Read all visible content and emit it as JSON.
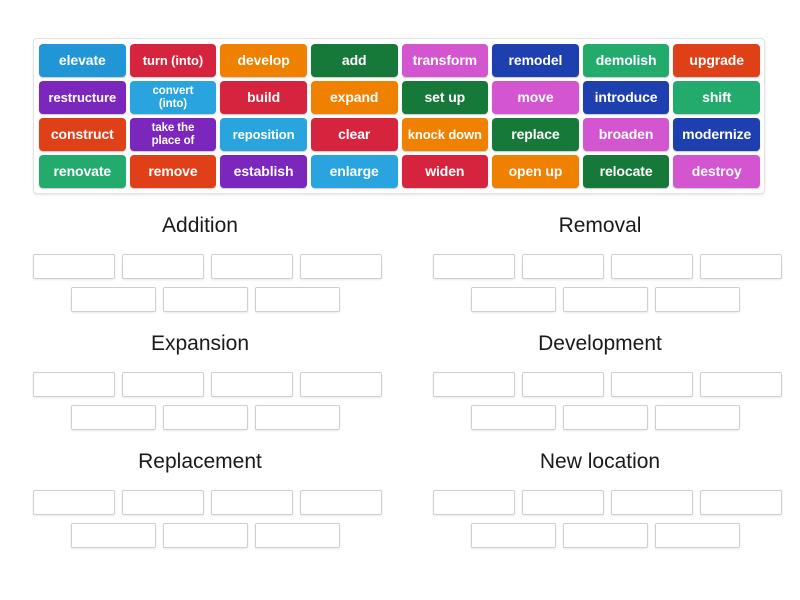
{
  "activity": {
    "type": "group-sort",
    "tile_text_color": "#ffffff",
    "page_background": "#ffffff",
    "panel_border_color": "#e2e2e2",
    "slot_border_color": "#cfcfcf"
  },
  "wordbank": {
    "rows": [
      [
        {
          "label": "elevate",
          "color": "#2196d6"
        },
        {
          "label": "turn (into)",
          "color": "#d7243e"
        },
        {
          "label": "develop",
          "color": "#f08000"
        },
        {
          "label": "add",
          "color": "#16793a"
        },
        {
          "label": "transform",
          "color": "#d355cf"
        },
        {
          "label": "remodel",
          "color": "#1d3fb0"
        },
        {
          "label": "demolish",
          "color": "#23ab6e"
        },
        {
          "label": "upgrade",
          "color": "#df4017"
        }
      ],
      [
        {
          "label": "restructure",
          "color": "#7b26bd"
        },
        {
          "label": "convert\n(into)",
          "color": "#29a4de"
        },
        {
          "label": "build",
          "color": "#d7243e"
        },
        {
          "label": "expand",
          "color": "#f08000"
        },
        {
          "label": "set up",
          "color": "#16793a"
        },
        {
          "label": "move",
          "color": "#d355cf"
        },
        {
          "label": "introduce",
          "color": "#1d3fb0"
        },
        {
          "label": "shift",
          "color": "#23ab6e"
        }
      ],
      [
        {
          "label": "construct",
          "color": "#df4017"
        },
        {
          "label": "take the\nplace of",
          "color": "#7b26bd"
        },
        {
          "label": "reposition",
          "color": "#29a4de"
        },
        {
          "label": "clear",
          "color": "#d7243e"
        },
        {
          "label": "knock down",
          "color": "#f08000"
        },
        {
          "label": "replace",
          "color": "#16793a"
        },
        {
          "label": "broaden",
          "color": "#d355cf"
        },
        {
          "label": "modernize",
          "color": "#1d3fb0"
        }
      ],
      [
        {
          "label": "renovate",
          "color": "#23ab6e"
        },
        {
          "label": "remove",
          "color": "#df4017"
        },
        {
          "label": "establish",
          "color": "#7b26bd"
        },
        {
          "label": "enlarge",
          "color": "#29a4de"
        },
        {
          "label": "widen",
          "color": "#d7243e"
        },
        {
          "label": "open up",
          "color": "#f08000"
        },
        {
          "label": "relocate",
          "color": "#16793a"
        },
        {
          "label": "destroy",
          "color": "#d355cf"
        }
      ]
    ]
  },
  "categories": [
    {
      "title": "Addition",
      "row1_slots": 4,
      "row2_slots": 3
    },
    {
      "title": "Removal",
      "row1_slots": 4,
      "row2_slots": 3
    },
    {
      "title": "Expansion",
      "row1_slots": 4,
      "row2_slots": 3
    },
    {
      "title": "Development",
      "row1_slots": 4,
      "row2_slots": 3
    },
    {
      "title": "Replacement",
      "row1_slots": 4,
      "row2_slots": 3
    },
    {
      "title": "New location",
      "row1_slots": 4,
      "row2_slots": 3
    }
  ]
}
